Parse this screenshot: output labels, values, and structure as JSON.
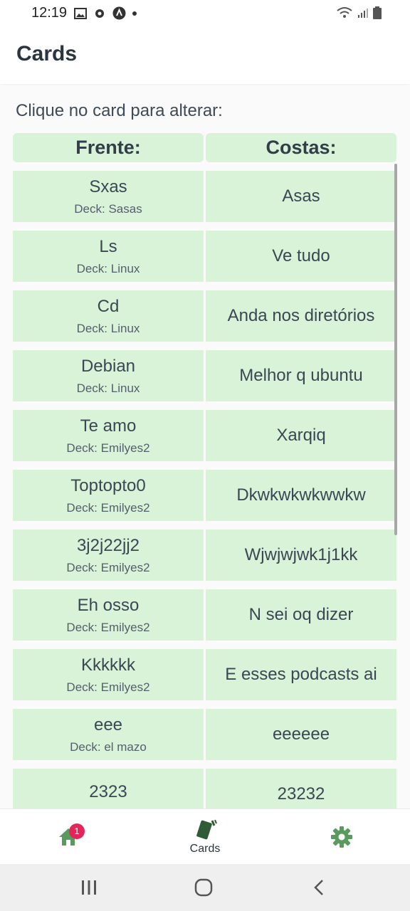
{
  "status_bar": {
    "time": "12:19"
  },
  "header": {
    "title": "Cards"
  },
  "instruction": "Clique no card para alterar:",
  "table": {
    "columns": [
      "Frente:",
      "Costas:"
    ],
    "rows": [
      {
        "front": "Sxas",
        "deck": "Deck: Sasas",
        "back": "Asas"
      },
      {
        "front": "Ls",
        "deck": "Deck: Linux",
        "back": "Ve tudo"
      },
      {
        "front": "Cd",
        "deck": "Deck: Linux",
        "back": "Anda nos diretórios"
      },
      {
        "front": "Debian",
        "deck": "Deck: Linux",
        "back": "Melhor q ubuntu"
      },
      {
        "front": "Te amo",
        "deck": "Deck: Emilyes2",
        "back": "Xarqiq"
      },
      {
        "front": "Toptopto0",
        "deck": "Deck: Emilyes2",
        "back": "Dkwkwkwkwwkw"
      },
      {
        "front": "3j2j22jj2",
        "deck": "Deck: Emilyes2",
        "back": "Wjwjwjwk1j1kk"
      },
      {
        "front": "Eh osso",
        "deck": "Deck: Emilyes2",
        "back": "N sei oq dizer"
      },
      {
        "front": "Kkkkkk",
        "deck": "Deck: Emilyes2",
        "back": "E esses podcasts ai"
      },
      {
        "front": "eee",
        "deck": "Deck: el mazo",
        "back": "eeeeee"
      },
      {
        "front": "2323",
        "deck": "",
        "back": "23232"
      }
    ]
  },
  "tabs": {
    "home": {
      "badge": "1",
      "icon": "home-icon"
    },
    "cards": {
      "label": "Cards",
      "icon": "cards-icon"
    },
    "settings": {
      "icon": "gear-icon"
    }
  },
  "colors": {
    "accent": "#5a9a5f",
    "card_bg": "#d9f3d9",
    "badge": "#e5245a"
  }
}
